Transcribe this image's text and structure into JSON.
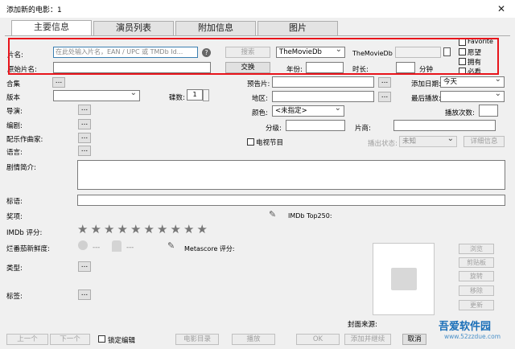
{
  "window": {
    "title": "添加新的电影：1",
    "close": "✕",
    "minimize": "—",
    "maximize": "☐"
  },
  "tabs": [
    "主要信息",
    "演员列表",
    "附加信息",
    "图片"
  ],
  "fields": {
    "title_label": "片名:",
    "title_placeholder": "在此处输入片名，EAN / UPC 或 TMDb Id...",
    "help": "?",
    "search_button": "搜索",
    "source_select": "TheMovieDb",
    "tmdb_id_label": "TheMovieDb Id:",
    "original_title_label": "原始片名:",
    "swap_button": "交换",
    "year_label": "年份:",
    "runtime_label": "时长:",
    "minutes": "分钟",
    "favorite": "Favorite",
    "wish": "愿望",
    "own": "拥有",
    "must": "必看",
    "collection": "合集",
    "edition": "版本",
    "discs_label": "碟数:",
    "discs_value": "1",
    "director": "导演:",
    "writer": "编剧:",
    "composer": "配乐作曲家:",
    "language": "语言:",
    "trailer_label": "预告片:",
    "date_added_label": "添加日期:",
    "date_added_value": "今天",
    "region_label": "地区:",
    "last_seen_label": "最后播放:",
    "play_count_label": "播放次数:",
    "color_label": "颜色:",
    "color_value": "<未指定>",
    "rating_label": "分级:",
    "studio_label": "片商:",
    "tv_label": "电视节目",
    "release_status_label": "播出状态:",
    "release_status_value": "未知",
    "detail_button": "详细信息",
    "plot_label": "剧情简介:",
    "tagline_label": "标语:",
    "awards_label": "奖项:",
    "imdb_top_label": "IMDb Top250:",
    "imdb_rating_label": "IMDb 评分:",
    "rt_label": "烂番茄新鲜度:",
    "rt_dash1": "---",
    "rt_dash2": "---",
    "metascore_label": "Metascore 评分:",
    "genre_label": "类型:",
    "tags_label": "标签:",
    "cover_source_label": "封面来源:",
    "browse": "浏览",
    "clipboard": "剪贴板",
    "rotate": "旋转",
    "remove": "移除",
    "update": "更新",
    "prev": "上一个",
    "next": "下一个",
    "lock_edit": "锁定编辑",
    "catalog": "电影目录",
    "play": "播放",
    "ok": "OK",
    "add_continue": "添加并继续",
    "cancel": "取消"
  },
  "imdb_stars": 10,
  "watermark": "吾爱软件园",
  "watermark_url": "www.52zzdue.com"
}
